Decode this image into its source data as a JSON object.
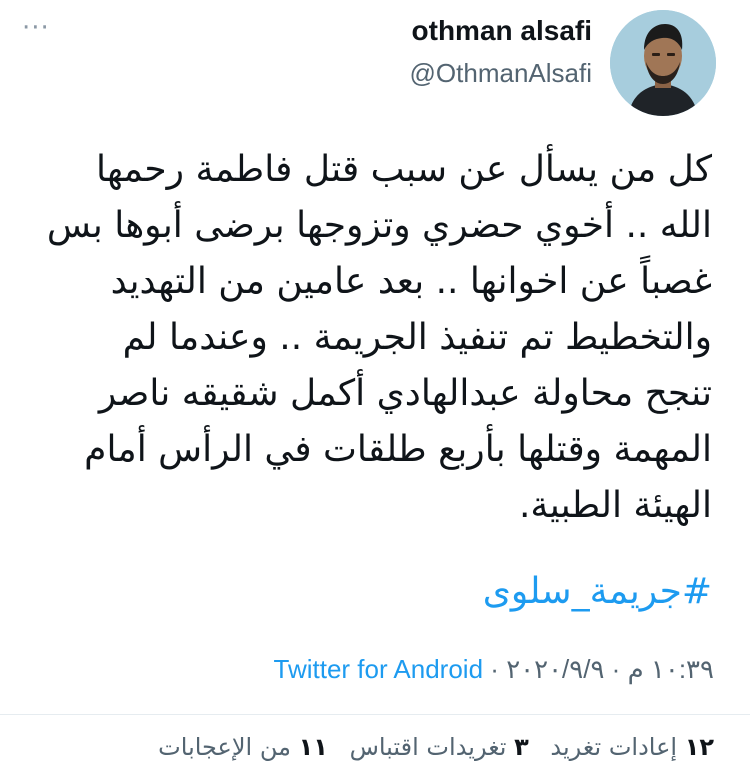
{
  "header": {
    "display_name": "othman alsafi",
    "handle": "@OthmanAlsafi",
    "more_icon": "more-horizontal-icon",
    "more_label": "···"
  },
  "tweet": {
    "lines": [
      "كل من يسأل عن سبب قتل فاطمة رحمها",
      "الله .. أخوي حضري وتزوجها برضى أبوها بس",
      "غصباً عن اخوانها .. بعد عامين من التهديد",
      "والتخطيط تم تنفيذ الجريمة .. وعندما لم",
      "تنجح محاولة عبدالهادي أكمل شقيقه ناصر",
      "المهمة وقتلها بأربع طلقات في الرأس أمام",
      "الهيئة الطبية."
    ],
    "hashtag": "#جريمة_سلوى"
  },
  "meta": {
    "time": "١٠:٣٩ م",
    "separator1": "·",
    "date": "٢٠٢٠/٩/٩",
    "separator2": "·",
    "source": "Twitter for Android"
  },
  "stats": {
    "retweets_count": "١٢",
    "retweets_label": "إعادات تغريد",
    "quotes_count": "٣",
    "quotes_label": "تغريدات اقتباس",
    "likes_count": "١١",
    "likes_label": "من الإعجابات"
  },
  "colors": {
    "link": "#1d9bf0",
    "secondary_text": "#536471",
    "primary_text": "#0f1419"
  }
}
